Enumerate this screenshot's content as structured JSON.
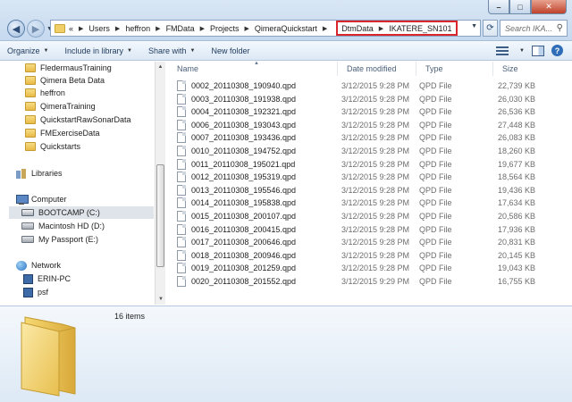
{
  "window": {
    "controls": {
      "minimize": "–",
      "maximize": "□",
      "close": "✕"
    }
  },
  "address": {
    "prefix": "«",
    "crumbs": [
      "Users",
      "heffron",
      "FMData",
      "Projects",
      "QimeraQuickstart"
    ],
    "highlighted_crumbs": [
      "DtmData",
      "IKATERE_SN101"
    ],
    "highlight_color": "#d9262c"
  },
  "search": {
    "placeholder": "Search IKA..."
  },
  "toolbar": {
    "organize": "Organize",
    "include_in_library": "Include in library",
    "share_with": "Share with",
    "new_folder": "New folder"
  },
  "nav": {
    "folders": [
      "FledermausTraining",
      "Qimera Beta Data",
      "heffron",
      "QimeraTraining",
      "QuickstartRawSonarData",
      "FMExerciseData",
      "Quickstarts"
    ],
    "libraries": "Libraries",
    "computer": "Computer",
    "drives": [
      "BOOTCAMP (C:)",
      "Macintosh HD (D:)",
      "My Passport (E:)"
    ],
    "network": "Network",
    "network_items": [
      "ERIN-PC",
      "psf"
    ]
  },
  "columns": {
    "name": "Name",
    "date": "Date modified",
    "type": "Type",
    "size": "Size"
  },
  "files": [
    {
      "name": "0002_20110308_190940.qpd",
      "date": "3/12/2015 9:28 PM",
      "type": "QPD File",
      "size": "22,739 KB"
    },
    {
      "name": "0003_20110308_191938.qpd",
      "date": "3/12/2015 9:28 PM",
      "type": "QPD File",
      "size": "26,030 KB"
    },
    {
      "name": "0004_20110308_192321.qpd",
      "date": "3/12/2015 9:28 PM",
      "type": "QPD File",
      "size": "26,536 KB"
    },
    {
      "name": "0006_20110308_193043.qpd",
      "date": "3/12/2015 9:28 PM",
      "type": "QPD File",
      "size": "27,448 KB"
    },
    {
      "name": "0007_20110308_193436.qpd",
      "date": "3/12/2015 9:28 PM",
      "type": "QPD File",
      "size": "26,083 KB"
    },
    {
      "name": "0010_20110308_194752.qpd",
      "date": "3/12/2015 9:28 PM",
      "type": "QPD File",
      "size": "18,260 KB"
    },
    {
      "name": "0011_20110308_195021.qpd",
      "date": "3/12/2015 9:28 PM",
      "type": "QPD File",
      "size": "19,677 KB"
    },
    {
      "name": "0012_20110308_195319.qpd",
      "date": "3/12/2015 9:28 PM",
      "type": "QPD File",
      "size": "18,564 KB"
    },
    {
      "name": "0013_20110308_195546.qpd",
      "date": "3/12/2015 9:28 PM",
      "type": "QPD File",
      "size": "19,436 KB"
    },
    {
      "name": "0014_20110308_195838.qpd",
      "date": "3/12/2015 9:28 PM",
      "type": "QPD File",
      "size": "17,634 KB"
    },
    {
      "name": "0015_20110308_200107.qpd",
      "date": "3/12/2015 9:28 PM",
      "type": "QPD File",
      "size": "20,586 KB"
    },
    {
      "name": "0016_20110308_200415.qpd",
      "date": "3/12/2015 9:28 PM",
      "type": "QPD File",
      "size": "17,936 KB"
    },
    {
      "name": "0017_20110308_200646.qpd",
      "date": "3/12/2015 9:28 PM",
      "type": "QPD File",
      "size": "20,831 KB"
    },
    {
      "name": "0018_20110308_200946.qpd",
      "date": "3/12/2015 9:28 PM",
      "type": "QPD File",
      "size": "20,145 KB"
    },
    {
      "name": "0019_20110308_201259.qpd",
      "date": "3/12/2015 9:28 PM",
      "type": "QPD File",
      "size": "19,043 KB"
    },
    {
      "name": "0020_20110308_201552.qpd",
      "date": "3/12/2015 9:29 PM",
      "type": "QPD File",
      "size": "16,755 KB"
    }
  ],
  "details": {
    "item_count": "16 items"
  }
}
